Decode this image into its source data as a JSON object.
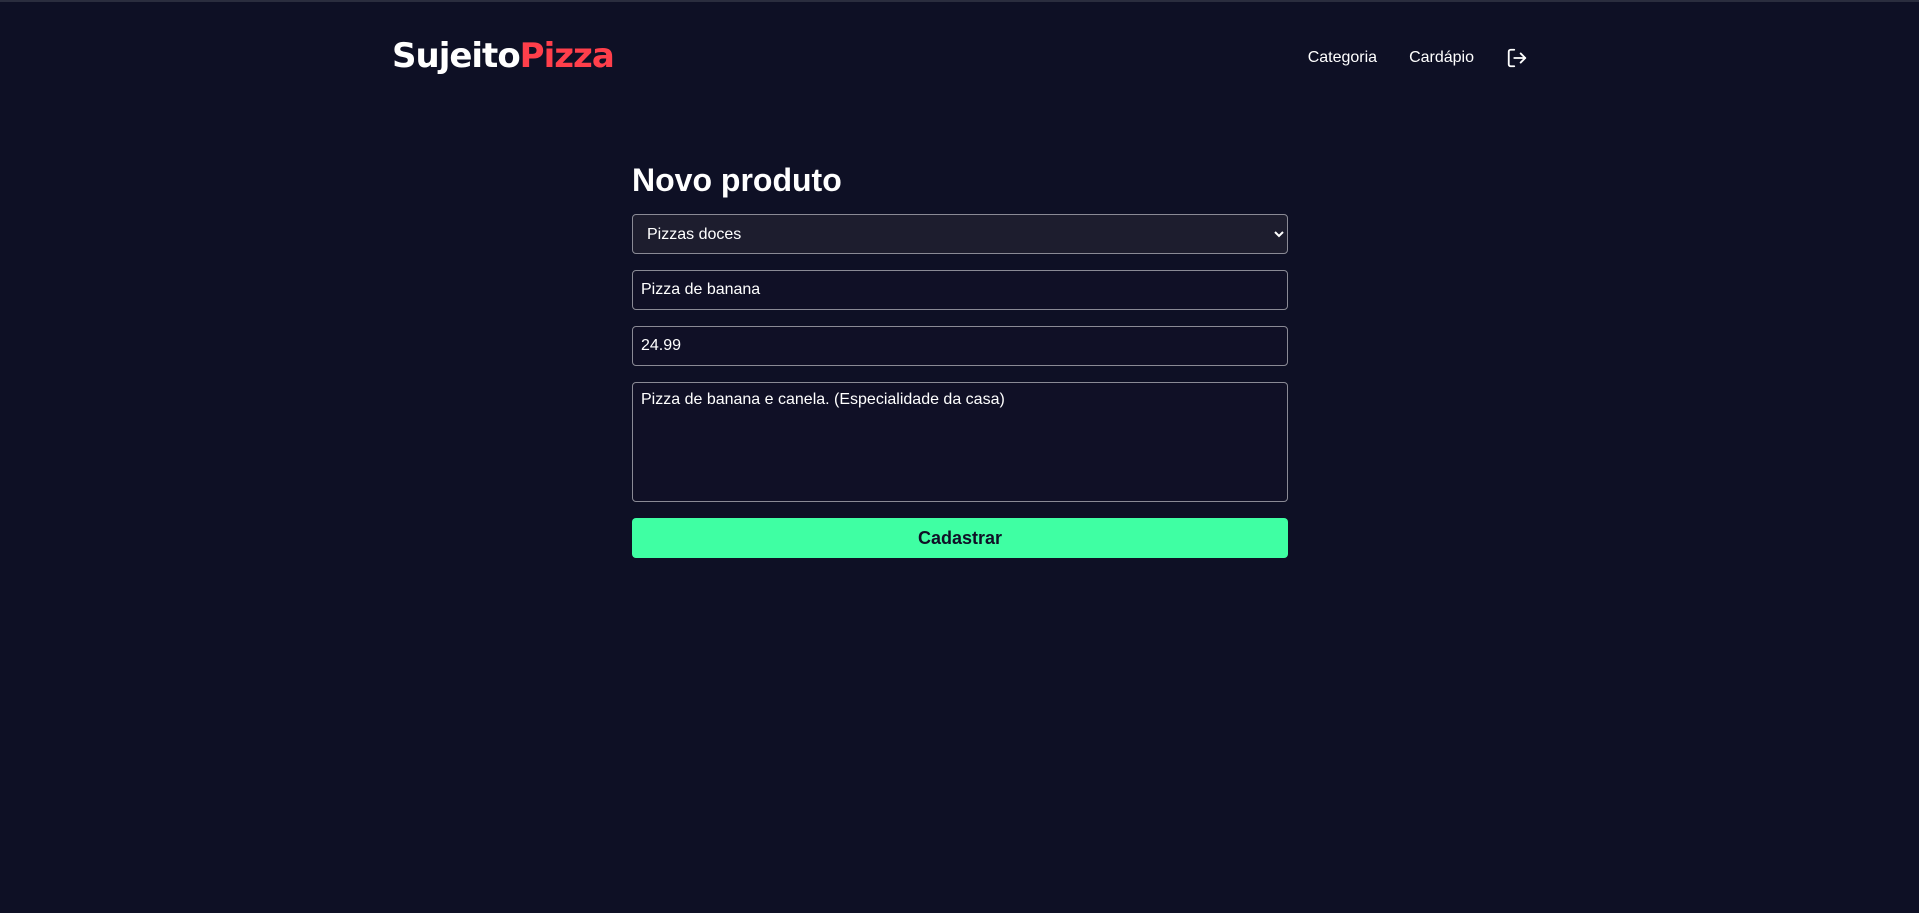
{
  "brand": {
    "part1": "Sujeito",
    "part2": "Pizza"
  },
  "nav": {
    "items": [
      {
        "label": "Categoria"
      },
      {
        "label": "Cardápio"
      }
    ],
    "logout_icon": "logout-icon"
  },
  "page": {
    "title": "Novo produto"
  },
  "form": {
    "category": {
      "selected": "Pizzas doces"
    },
    "name": {
      "value": "Pizza de banana"
    },
    "price": {
      "value": "24.99"
    },
    "description": {
      "value": "Pizza de banana e canela. (Especialidade da casa)"
    },
    "submit_label": "Cadastrar"
  },
  "colors": {
    "background": "#0e1025",
    "brand_accent": "#ff3f4b",
    "button": "#3fffa3"
  }
}
